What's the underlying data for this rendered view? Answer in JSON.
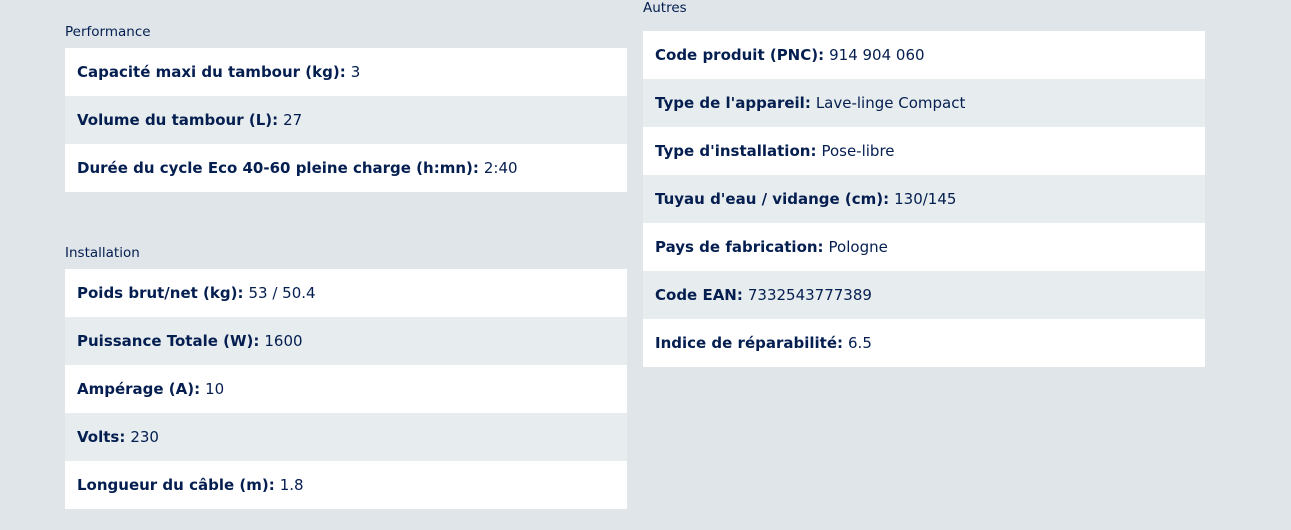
{
  "performance": {
    "title": "Performance",
    "rows": [
      {
        "label": "Capacité maxi du tambour (kg)",
        "value": "3"
      },
      {
        "label": "Volume du tambour (L)",
        "value": "27"
      },
      {
        "label": "Durée du cycle Eco 40-60 pleine charge (h:mn)",
        "value": "2:40"
      }
    ]
  },
  "installation": {
    "title": "Installation",
    "rows": [
      {
        "label": "Poids brut/net (kg)",
        "value": "53 / 50.4"
      },
      {
        "label": "Puissance Totale (W)",
        "value": "1600"
      },
      {
        "label": "Ampérage (A)",
        "value": "10"
      },
      {
        "label": "Volts",
        "value": "230"
      },
      {
        "label": "Longueur du câble (m)",
        "value": "1.8"
      }
    ]
  },
  "autres": {
    "title": "Autres",
    "rows": [
      {
        "label": "Code produit (PNC)",
        "value": "914 904 060"
      },
      {
        "label": "Type de l'appareil",
        "value": "Lave-linge Compact"
      },
      {
        "label": "Type d'installation",
        "value": "Pose-libre"
      },
      {
        "label": "Tuyau d'eau / vidange (cm)",
        "value": "130/145"
      },
      {
        "label": "Pays de fabrication",
        "value": "Pologne"
      },
      {
        "label": "Code EAN",
        "value": "7332543777389"
      },
      {
        "label": "Indice de réparabilité",
        "value": "6.5"
      }
    ]
  },
  "colors": {
    "text": "#041e50",
    "background": "#dfe5e9",
    "row_light": "#ffffff",
    "row_alt": "#e7ecee"
  }
}
